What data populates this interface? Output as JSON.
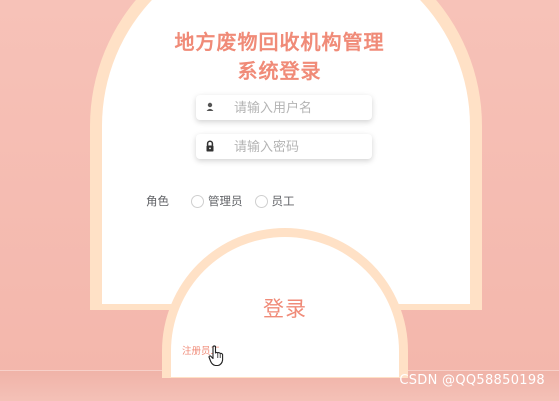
{
  "title": {
    "line1": "地方废物回收机构管理",
    "line2": "系统登录"
  },
  "username": {
    "placeholder": "请输入用户名",
    "icon": "user-icon"
  },
  "password": {
    "placeholder": "请输入密码",
    "icon": "lock-icon"
  },
  "role": {
    "label": "角色",
    "options": [
      "管理员",
      "员工"
    ]
  },
  "login_label": "登录",
  "register_link": "注册员工",
  "watermark": "CSDN @QQ58850198",
  "colors": {
    "accent": "#f08b78",
    "background": "#f7c2b8",
    "arch_border": "#ffe1c6",
    "card": "#ffffff"
  }
}
